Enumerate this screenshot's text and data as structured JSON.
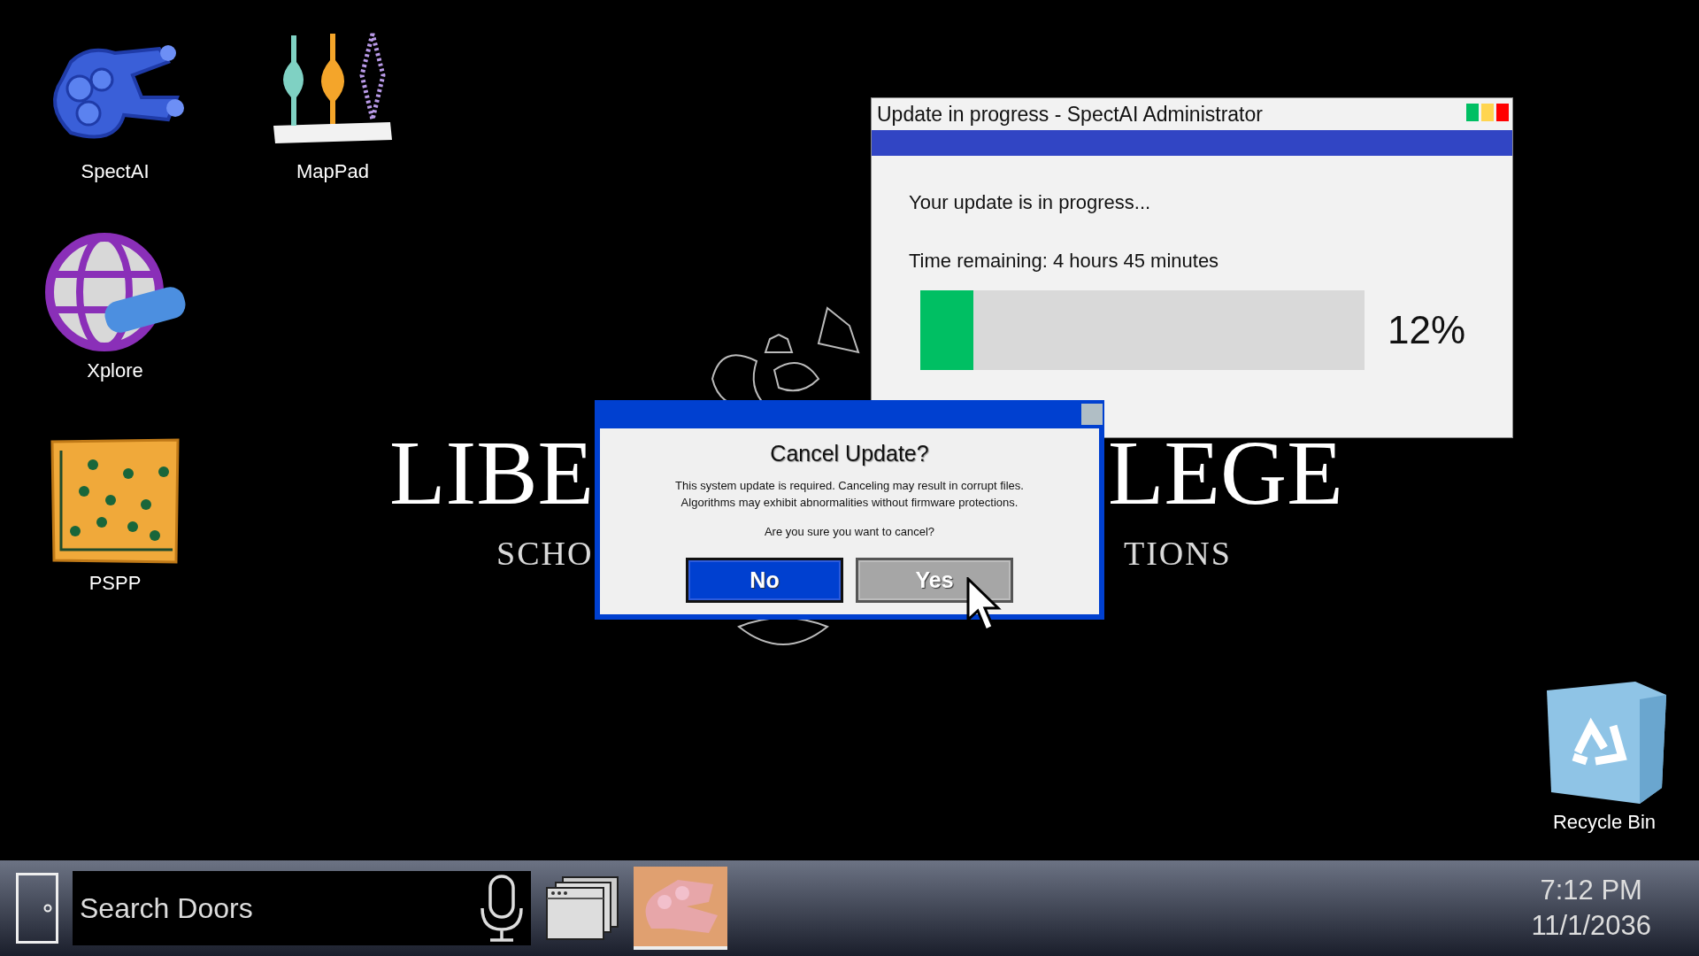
{
  "desktop_icons": [
    {
      "label": "SpectAI",
      "kind": "hand"
    },
    {
      "label": "MapPad",
      "kind": "vases"
    },
    {
      "label": "Xplore",
      "kind": "globe"
    },
    {
      "label": "PSPP",
      "kind": "board"
    },
    {
      "label": "Recycle Bin",
      "kind": "recycle"
    }
  ],
  "wallpaper": {
    "texts": [
      "LIBE",
      "LEGE",
      "SCHO",
      "TIONS"
    ]
  },
  "update_window": {
    "title": "Update in progress - SpectAI Administrator",
    "message": "Your update is in progress...",
    "time_remaining": "Time remaining: 4 hours 45 minutes",
    "progress": {
      "level": 0.12,
      "reading": "12%"
    }
  },
  "dialog": {
    "title": "Cancel Update?",
    "message_lines": [
      "This system update is required. Canceling may result in corrupt files.",
      "Algorithms may exhibit abnormalities without firmware protections."
    ],
    "question": "Are you sure you want to cancel?",
    "buttons": [
      {
        "label": "No",
        "kind": "primary"
      },
      {
        "label": "Yes",
        "kind": "secondary"
      }
    ]
  },
  "taskbar": {
    "search": {
      "placeholder": "Search Doors"
    },
    "clock": {
      "time": "7:12 PM",
      "date": "11/1/2036"
    }
  }
}
